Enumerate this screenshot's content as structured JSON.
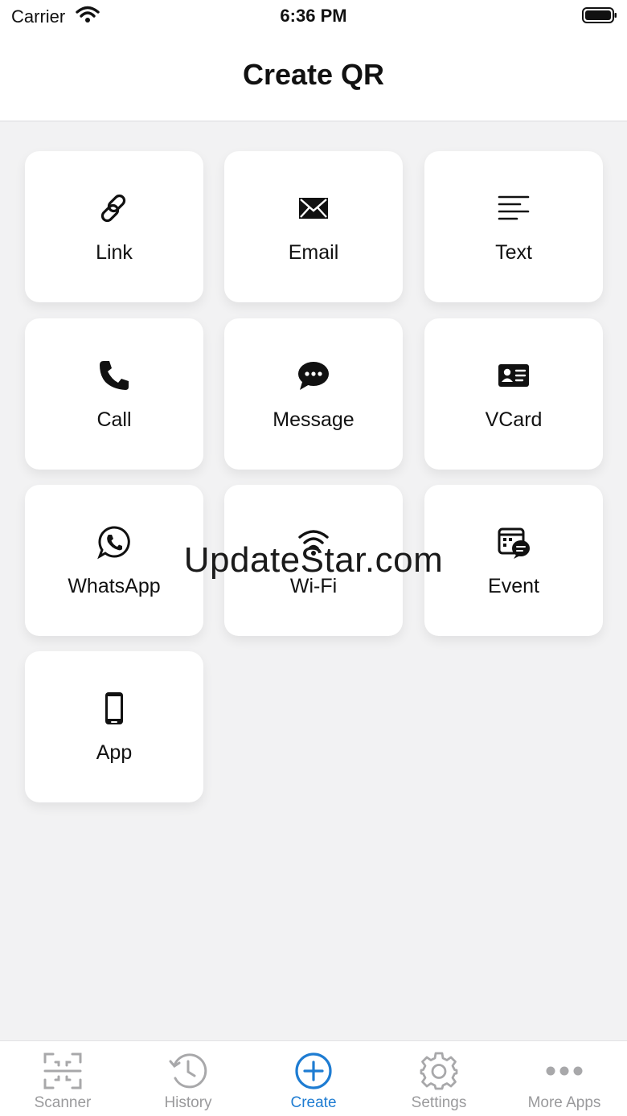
{
  "status_bar": {
    "carrier": "Carrier",
    "time": "6:36 PM"
  },
  "header": {
    "title": "Create QR"
  },
  "options": [
    {
      "label": "Link",
      "icon": "link-icon"
    },
    {
      "label": "Email",
      "icon": "envelope-icon"
    },
    {
      "label": "Text",
      "icon": "text-lines-icon"
    },
    {
      "label": "Call",
      "icon": "phone-icon"
    },
    {
      "label": "Message",
      "icon": "chat-bubble-icon"
    },
    {
      "label": "VCard",
      "icon": "contact-card-icon"
    },
    {
      "label": "WhatsApp",
      "icon": "whatsapp-icon"
    },
    {
      "label": "Wi-Fi",
      "icon": "wifi-icon"
    },
    {
      "label": "Event",
      "icon": "calendar-chat-icon"
    },
    {
      "label": "App",
      "icon": "smartphone-icon"
    }
  ],
  "watermark": "UpdateStar.com",
  "tabs": [
    {
      "label": "Scanner",
      "icon": "scanner-frame-icon",
      "active": false
    },
    {
      "label": "History",
      "icon": "history-clock-icon",
      "active": false
    },
    {
      "label": "Create",
      "icon": "plus-circle-icon",
      "active": true
    },
    {
      "label": "Settings",
      "icon": "gear-icon",
      "active": false
    },
    {
      "label": "More Apps",
      "icon": "ellipsis-icon",
      "active": false
    }
  ],
  "colors": {
    "accent": "#1e7cd2",
    "inactive": "#9a9a9c",
    "background": "#f2f2f3",
    "card": "#ffffff"
  }
}
